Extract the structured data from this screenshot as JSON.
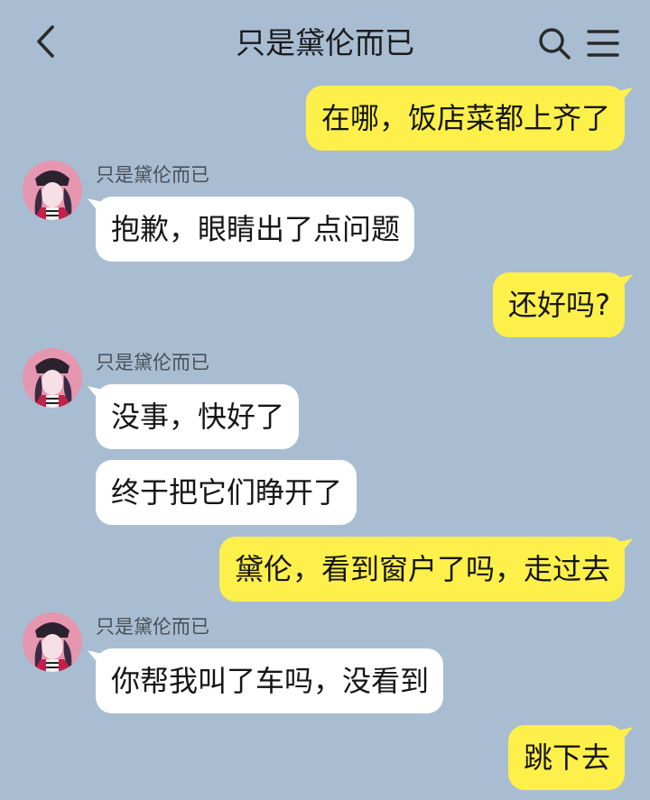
{
  "header": {
    "title": "只是黛伦而已",
    "back_icon": "chevron-left-icon",
    "search_icon": "search-icon",
    "menu_icon": "hamburger-menu-icon"
  },
  "colors": {
    "background": "#a9bdd2",
    "outgoing_bubble": "#fef04a",
    "incoming_bubble": "#ffffff"
  },
  "messages": [
    {
      "direction": "outgoing",
      "text": "在哪，饭店菜都上齐了"
    },
    {
      "direction": "incoming",
      "sender": "只是黛伦而已",
      "text": "抱歉，眼睛出了点问题"
    },
    {
      "direction": "outgoing",
      "text": "还好吗?"
    },
    {
      "direction": "incoming",
      "sender": "只是黛伦而已",
      "text": "没事，快好了"
    },
    {
      "direction": "incoming",
      "text": "终于把它们睁开了"
    },
    {
      "direction": "outgoing",
      "text": "黛伦，看到窗户了吗，走过去"
    },
    {
      "direction": "incoming",
      "sender": "只是黛伦而已",
      "text": "你帮我叫了车吗，没看到"
    },
    {
      "direction": "outgoing",
      "text": "跳下去"
    }
  ]
}
